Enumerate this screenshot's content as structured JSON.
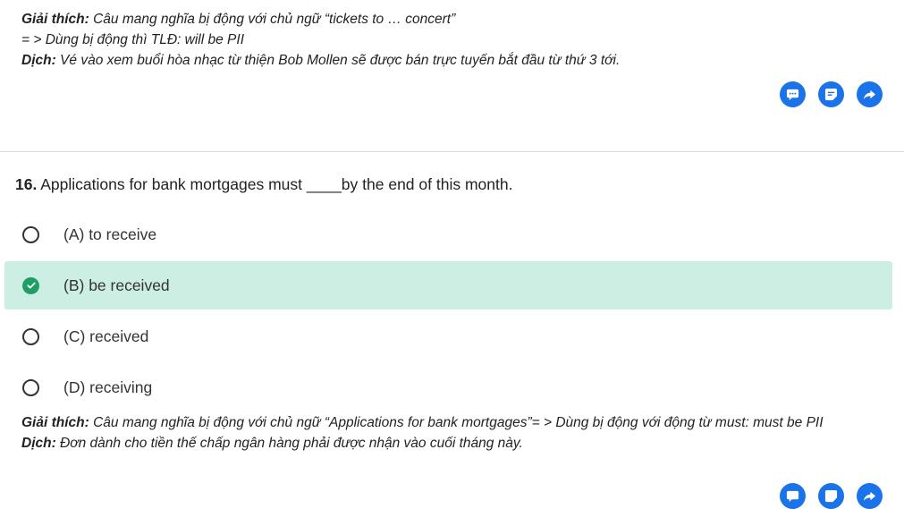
{
  "prev_explanation": {
    "explain_label": "Giải thích:",
    "explain_text": " Câu mang nghĩa bị động với chủ ngữ “tickets to … concert”",
    "rule_text": "= > Dùng bị động thì TLĐ: will be PII",
    "translate_label": "Dịch:",
    "translate_text": " Vé vào xem buổi hòa nhạc từ thiện Bob Mollen sẽ được bán trực tuyến bắt đầu từ thứ 3 tới."
  },
  "question": {
    "number": "16.",
    "text": " Applications for bank mortgages must ____by the end of this month.",
    "options": [
      {
        "label": "(A) to receive",
        "selected": false
      },
      {
        "label": "(B) be received",
        "selected": true
      },
      {
        "label": "(C) received",
        "selected": false
      },
      {
        "label": "(D) receiving",
        "selected": false
      }
    ]
  },
  "explanation": {
    "explain_label": "Giải thích:",
    "explain_text": " Câu mang nghĩa bị động với chủ ngữ “Applications for bank mortgages”= > Dùng bị động với động từ must: must be PII",
    "translate_label": "Dịch:",
    "translate_text": " Đơn dành cho tiền thế chấp ngân hàng phải được nhận vào cuối tháng này."
  },
  "icons": {
    "comment": "comment-icon",
    "note": "note-icon",
    "share": "share-icon"
  },
  "colors": {
    "accent": "#1a73e8",
    "correct_bg": "#cdeee3",
    "correct_check": "#1e9e64"
  }
}
